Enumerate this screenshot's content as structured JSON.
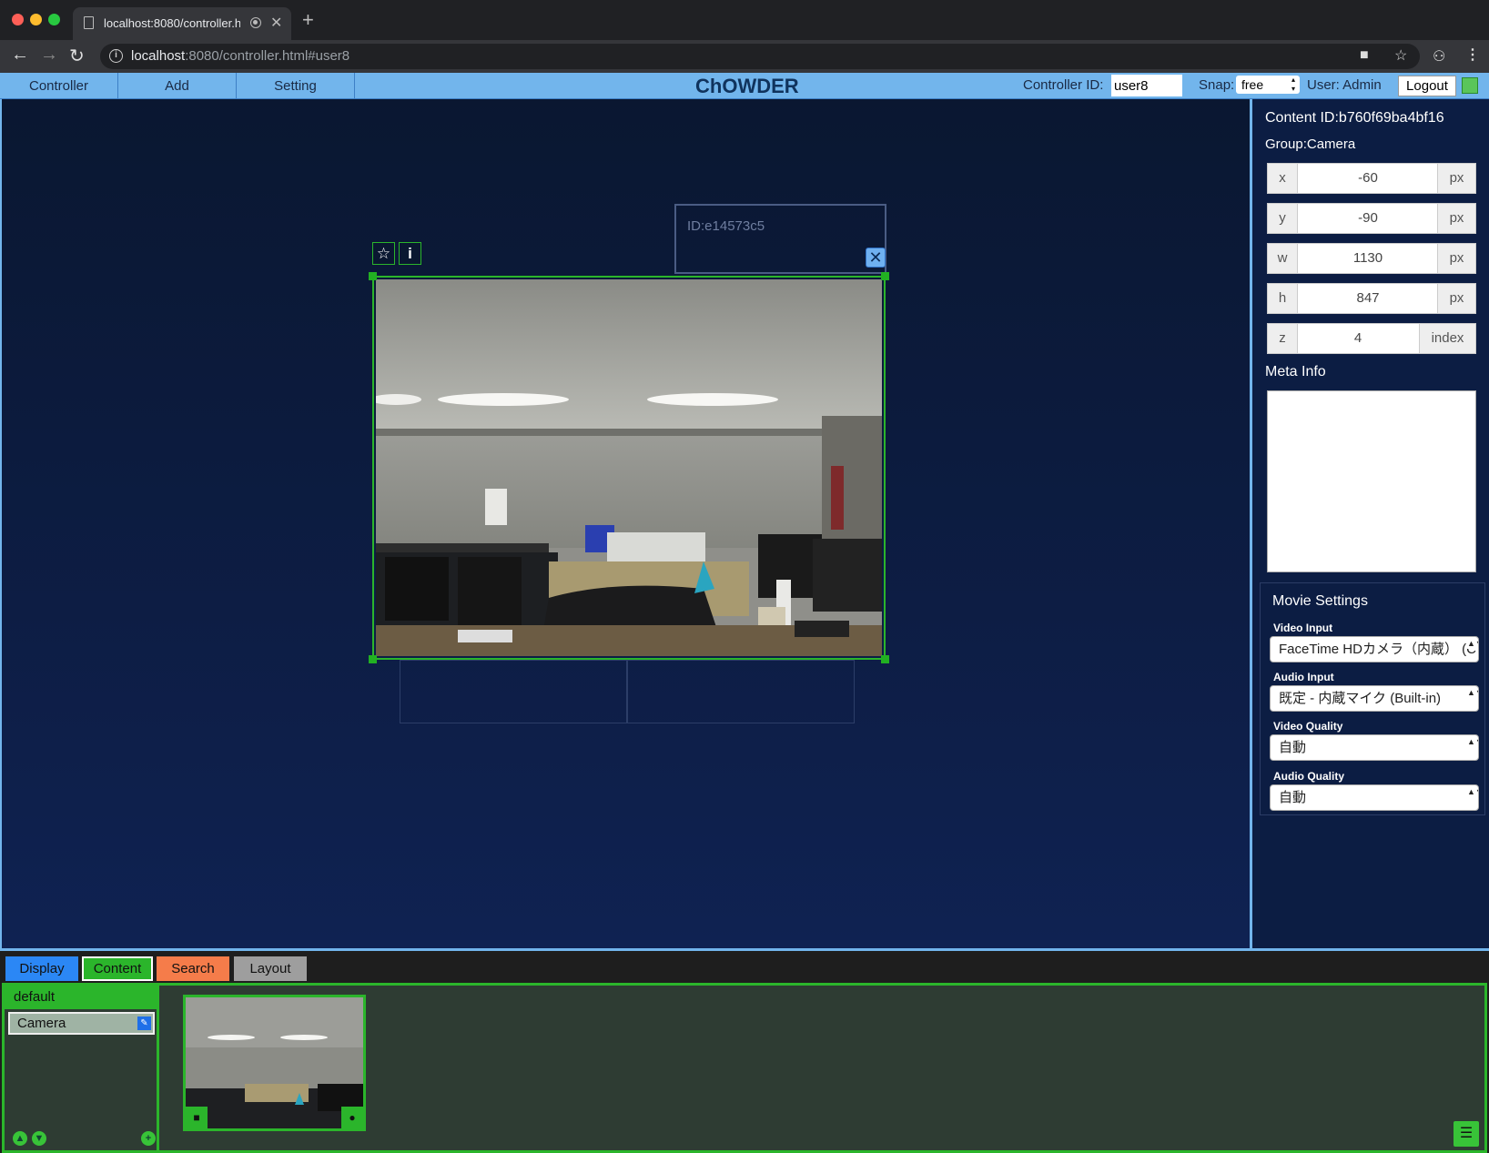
{
  "browser": {
    "tab_title": "localhost:8080/controller.h",
    "new_tab": "+",
    "url_host": "localhost",
    "url_rest": ":8080/controller.html#user8"
  },
  "header": {
    "menus": [
      "Controller",
      "Add",
      "Setting"
    ],
    "title": "ChOWDER",
    "controller_id_label": "Controller ID:",
    "controller_id_value": "user8",
    "snap_label": "Snap:",
    "snap_value": "free",
    "user_label": "User: Admin",
    "logout_label": "Logout"
  },
  "workspace": {
    "display_id": "ID:e14573c5",
    "favorite_icon": "star-icon",
    "info_icon": "info-icon",
    "info_glyph": "i",
    "close_icon": "close-icon"
  },
  "properties": {
    "content_id": "Content ID:b760f69ba4bf16",
    "group": "Group:Camera",
    "fields": [
      {
        "label": "x",
        "value": "-60",
        "unit": "px"
      },
      {
        "label": "y",
        "value": "-90",
        "unit": "px"
      },
      {
        "label": "w",
        "value": "1130",
        "unit": "px"
      },
      {
        "label": "h",
        "value": "847",
        "unit": "px"
      },
      {
        "label": "z",
        "value": "4",
        "unit": "index"
      }
    ],
    "meta_info_label": "Meta Info",
    "meta_info_value": ""
  },
  "movie_settings": {
    "title": "Movie Settings",
    "video_input_label": "Video Input",
    "video_input_value": "FaceTime HDカメラ（内蔵） (C",
    "audio_input_label": "Audio Input",
    "audio_input_value": "既定 - 内蔵マイク (Built-in)",
    "video_quality_label": "Video Quality",
    "video_quality_value": "自動",
    "audio_quality_label": "Audio Quality",
    "audio_quality_value": "自動"
  },
  "bottom": {
    "tabs": [
      {
        "label": "Display",
        "color": "#2b87f5"
      },
      {
        "label": "Content",
        "color": "#2bb52b"
      },
      {
        "label": "Search",
        "color": "#f57c4a"
      },
      {
        "label": "Layout",
        "color": "#9e9e9e"
      }
    ],
    "groups": [
      "default",
      "Camera"
    ],
    "thumb_video_icon": "video-camera-icon",
    "thumb_mic_icon": "microphone-icon"
  },
  "colors": {
    "accent_blue": "#72b5ec",
    "selection_green": "#2bb52b",
    "workspace_bg": "#0c1d43"
  }
}
